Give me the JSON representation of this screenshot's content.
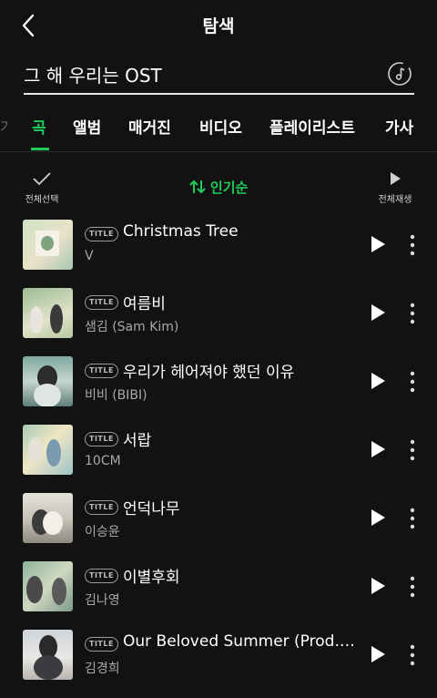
{
  "header": {
    "title": "탐색"
  },
  "search": {
    "query": "그 해 우리는 OST"
  },
  "tabs": [
    {
      "label": "곡",
      "active": true
    },
    {
      "label": "앨범"
    },
    {
      "label": "매거진"
    },
    {
      "label": "비디오"
    },
    {
      "label": "플레이리스트"
    },
    {
      "label": "가사"
    }
  ],
  "toolbar": {
    "select_all": "전체선택",
    "sort": "인기순",
    "play_all": "전체재생"
  },
  "badge": "TITLE",
  "tracks": [
    {
      "title": "Christmas Tree",
      "artist": "V"
    },
    {
      "title": "여름비",
      "artist": "샘김 (Sam Kim)"
    },
    {
      "title": "우리가 헤어져야 했던 이유",
      "artist": "비비 (BIBI)"
    },
    {
      "title": "서랍",
      "artist": "10CM"
    },
    {
      "title": "언덕나무",
      "artist": "이승윤"
    },
    {
      "title": "이별후회",
      "artist": "김나영"
    },
    {
      "title": "Our Beloved Summer (Prod. b...",
      "artist": "김경희"
    }
  ],
  "colors": {
    "accent": "#1ecc5a",
    "background": "#121212"
  },
  "icons": [
    "back-arrow-icon",
    "music-search-icon",
    "checkmark-icon",
    "sort-arrows-icon",
    "play-icon",
    "more-vertical-icon"
  ]
}
